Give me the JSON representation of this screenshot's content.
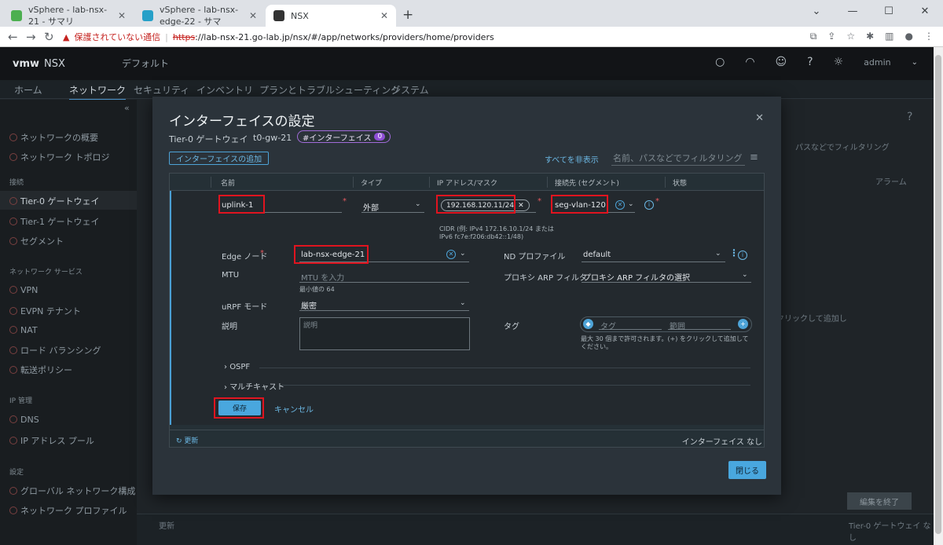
{
  "browser": {
    "tabs": [
      {
        "title": "vSphere - lab-nsx-21 - サマリ",
        "color": "#4caf50"
      },
      {
        "title": "vSphere - lab-nsx-edge-22 - サマ",
        "color": "#26a0c8"
      },
      {
        "title": "NSX",
        "color": "#333333"
      }
    ],
    "security_warning": "保護されていない通信",
    "url_scheme": "https",
    "url_rest": "://lab-nsx-21.go-lab.jp/nsx/#/app/networks/providers/home/providers"
  },
  "header": {
    "brand": "vmw",
    "product": "NSX",
    "project": "デフォルト",
    "user": "admin"
  },
  "topnav": {
    "items": [
      "ホーム",
      "ネットワーク",
      "セキュリティ",
      "インベントリ",
      "プランとトラブルシューティング",
      "システム"
    ]
  },
  "sidebar": {
    "items": {
      "overview": "ネットワークの概要",
      "topology": "ネットワーク トポロジ",
      "sec_connect": "接続",
      "t0": "Tier-0 ゲートウェイ",
      "t1": "Tier-1 ゲートウェイ",
      "segment": "セグメント",
      "sec_services": "ネットワーク サービス",
      "vpn": "VPN",
      "evpn": "EVPN テナント",
      "nat": "NAT",
      "lb": "ロード バランシング",
      "forward": "転送ポリシー",
      "sec_ip": "IP 管理",
      "dns": "DNS",
      "ippool": "IP アドレス プール",
      "sec_settings": "設定",
      "global": "グローバル ネットワーク構成",
      "profiles": "ネットワーク プロファイル"
    }
  },
  "background": {
    "filter_text": "パスなどでフィルタリング",
    "alarm_col": "アラーム",
    "add_hint": "クリックして追加し",
    "edit_end": "編集を終了",
    "refresh": "更新",
    "gw_none": "Tier-0 ゲートウェイ なし"
  },
  "modal": {
    "title": "インターフェイスの設定",
    "gateway_label": "Tier-0 ゲートウェイ",
    "gateway_id": "t0-gw-21",
    "badge_label": "#インターフェイス",
    "badge_count": "0",
    "add_button": "インターフェイスの追加",
    "hide_all": "すべてを非表示",
    "filter_placeholder": "名前、パスなどでフィルタリング",
    "columns": [
      "名前",
      "タイプ",
      "IP アドレス/マスク",
      "接続先 (セグメント)",
      "状態"
    ],
    "row": {
      "name": "uplink-1",
      "type": "外部",
      "ip": "192.168.120.11/24",
      "ip_hint": "CIDR (例: IPv4 172.16.10.1/24 または IPv6 fc7e:f206:db42::1/48)",
      "segment": "seg-vlan-120",
      "edge_label": "Edge ノード",
      "edge_value": "lab-nsx-edge-21",
      "mtu_label": "MTU",
      "mtu_placeholder": "MTU を入力",
      "mtu_hint": "最小値の 64",
      "urpf_label": "uRPF モード",
      "urpf_value": "厳密",
      "desc_label": "説明",
      "desc_placeholder": "説明",
      "nd_label": "ND プロファイル",
      "nd_value": "default",
      "proxy_label": "プロキシ ARP フィルタ",
      "proxy_value": "プロキシ ARP フィルタの選択",
      "tag_label": "タグ",
      "tag_placeholder": "タグ",
      "scope_placeholder": "範囲",
      "tag_hint": "最大 30 個まで許可されます。(+) をクリックして追加してください。",
      "ospf": "OSPF",
      "multicast": "マルチキャスト",
      "save": "保存",
      "cancel": "キャンセル"
    },
    "footer_refresh": "更新",
    "footer_none": "インターフェイス なし",
    "close_button": "閉じる"
  }
}
